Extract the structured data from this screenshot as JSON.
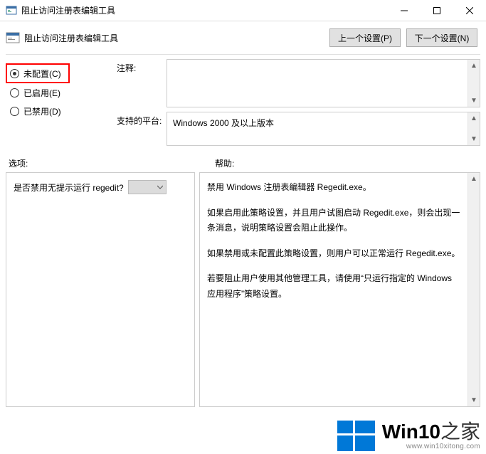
{
  "titlebar": {
    "title": "阻止访问注册表编辑工具"
  },
  "subheader": {
    "title": "阻止访问注册表编辑工具",
    "prev": "上一个设置(P)",
    "next": "下一个设置(N)"
  },
  "radios": {
    "not_configured": "未配置(C)",
    "enabled": "已启用(E)",
    "disabled": "已禁用(D)"
  },
  "fields": {
    "comment_label": "注释:",
    "platform_label": "支持的平台:",
    "platform_value": "Windows 2000 及以上版本"
  },
  "section_labels": {
    "options": "选项:",
    "help": "帮助:"
  },
  "options": {
    "question": "是否禁用无提示运行 regedit?"
  },
  "help": {
    "p1": "禁用 Windows 注册表编辑器 Regedit.exe。",
    "p2": "如果启用此策略设置，并且用户试图启动 Regedit.exe，则会出现一条消息，说明策略设置会阻止此操作。",
    "p3": "如果禁用或未配置此策略设置，则用户可以正常运行 Regedit.exe。",
    "p4": "若要阻止用户使用其他管理工具，请使用“只运行指定的 Windows 应用程序”策略设置。"
  },
  "watermark": {
    "brand_a": "Win10",
    "brand_b": "之家",
    "url": "www.win10xitong.com"
  }
}
